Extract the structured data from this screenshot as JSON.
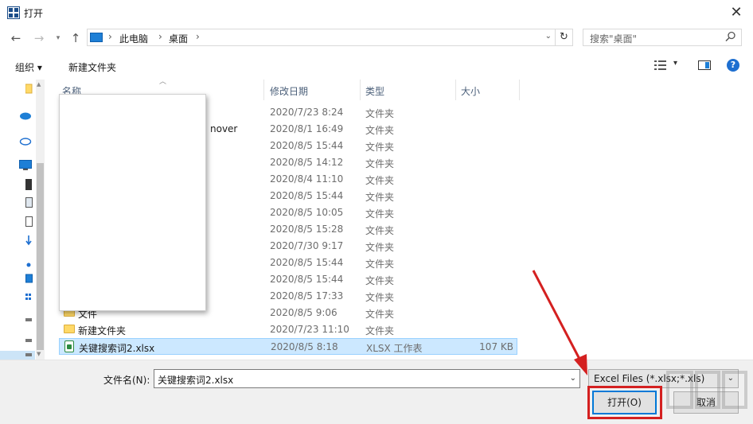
{
  "window": {
    "title": "打开",
    "close_glyph": "✕"
  },
  "address": {
    "crumbs": [
      "此电脑",
      "桌面"
    ],
    "search_placeholder": "搜索\"桌面\""
  },
  "toolbar": {
    "organize_label": "组织 ▾",
    "new_folder_label": "新建文件夹"
  },
  "columns": {
    "name": "名称",
    "date": "修改日期",
    "type": "类型",
    "size": "大小"
  },
  "files": [
    {
      "name": "",
      "date": "2020/7/23 8:24",
      "type": "文件夹",
      "size": "",
      "icon": "folder-icon"
    },
    {
      "name": "nover",
      "date": "2020/8/1 16:49",
      "type": "文件夹",
      "size": "",
      "icon": "folder-icon"
    },
    {
      "name": "",
      "date": "2020/8/5 15:44",
      "type": "文件夹",
      "size": "",
      "icon": "folder-icon"
    },
    {
      "name": "",
      "date": "2020/8/5 14:12",
      "type": "文件夹",
      "size": "",
      "icon": "folder-icon"
    },
    {
      "name": "",
      "date": "2020/8/4 11:10",
      "type": "文件夹",
      "size": "",
      "icon": "folder-icon"
    },
    {
      "name": "",
      "date": "2020/8/5 15:44",
      "type": "文件夹",
      "size": "",
      "icon": "folder-icon"
    },
    {
      "name": "",
      "date": "2020/8/5 10:05",
      "type": "文件夹",
      "size": "",
      "icon": "folder-icon"
    },
    {
      "name": "",
      "date": "2020/8/5 15:28",
      "type": "文件夹",
      "size": "",
      "icon": "folder-icon"
    },
    {
      "name": "",
      "date": "2020/7/30 9:17",
      "type": "文件夹",
      "size": "",
      "icon": "folder-icon"
    },
    {
      "name": "",
      "date": "2020/8/5 15:44",
      "type": "文件夹",
      "size": "",
      "icon": "folder-icon"
    },
    {
      "name": "",
      "date": "2020/8/5 15:44",
      "type": "文件夹",
      "size": "",
      "icon": "folder-icon"
    },
    {
      "name": "",
      "date": "2020/8/5 17:33",
      "type": "文件夹",
      "size": "",
      "icon": "folder-icon"
    },
    {
      "name": "文件",
      "date": "2020/8/5 9:06",
      "type": "文件夹",
      "size": "",
      "icon": "folder-icon"
    },
    {
      "name": "新建文件夹",
      "date": "2020/7/23 11:10",
      "type": "文件夹",
      "size": "",
      "icon": "folder-icon"
    },
    {
      "name": "关键搜索词2.xlsx",
      "date": "2020/8/5 8:18",
      "type": "XLSX 工作表",
      "size": "107 KB",
      "icon": "xlsx-file-icon",
      "selected": true
    }
  ],
  "bottom": {
    "filename_label": "文件名(N):",
    "filename_value": "关键搜索词2.xlsx",
    "filter_value": "Excel Files (*.xlsx;*.xls)",
    "open_label": "打开(O)",
    "cancel_label": "取消"
  },
  "colors": {
    "accent": "#0078d7",
    "selection": "#cce8ff",
    "highlight_red": "#d42020"
  }
}
